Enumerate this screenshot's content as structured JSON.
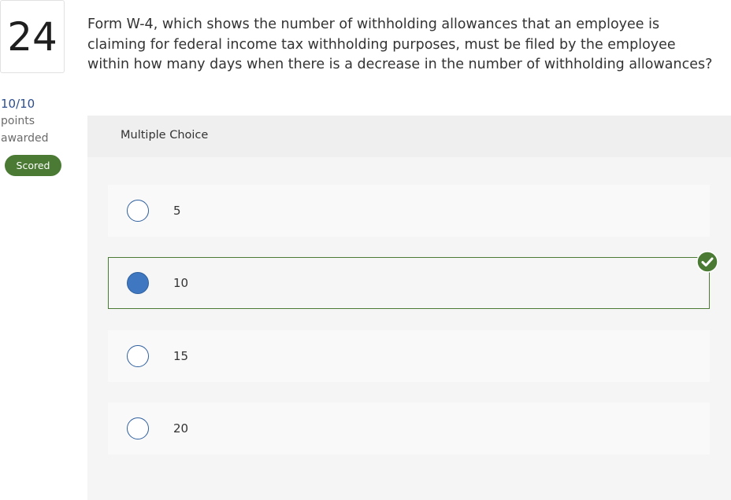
{
  "question": {
    "number": "24",
    "text": "Form W-4, which shows the number of withholding allowances that an employee is claiming for federal income tax withholding purposes, must be filed by the employee within how many days when there is a decrease in the number of withholding allowances?"
  },
  "score": {
    "points": "10/10",
    "points_label": "points",
    "awarded_label": "awarded",
    "status": "Scored"
  },
  "multiple_choice": {
    "header": "Multiple Choice",
    "choices": [
      {
        "label": "5",
        "selected": false
      },
      {
        "label": "10",
        "selected": true,
        "correct": true
      },
      {
        "label": "15",
        "selected": false
      },
      {
        "label": "20",
        "selected": false
      }
    ]
  },
  "colors": {
    "accent_green": "#4a7a34",
    "radio_blue": "#3f78c0",
    "points_blue": "#2b4d8f"
  },
  "icons": {
    "correct": "check-circle-icon"
  }
}
